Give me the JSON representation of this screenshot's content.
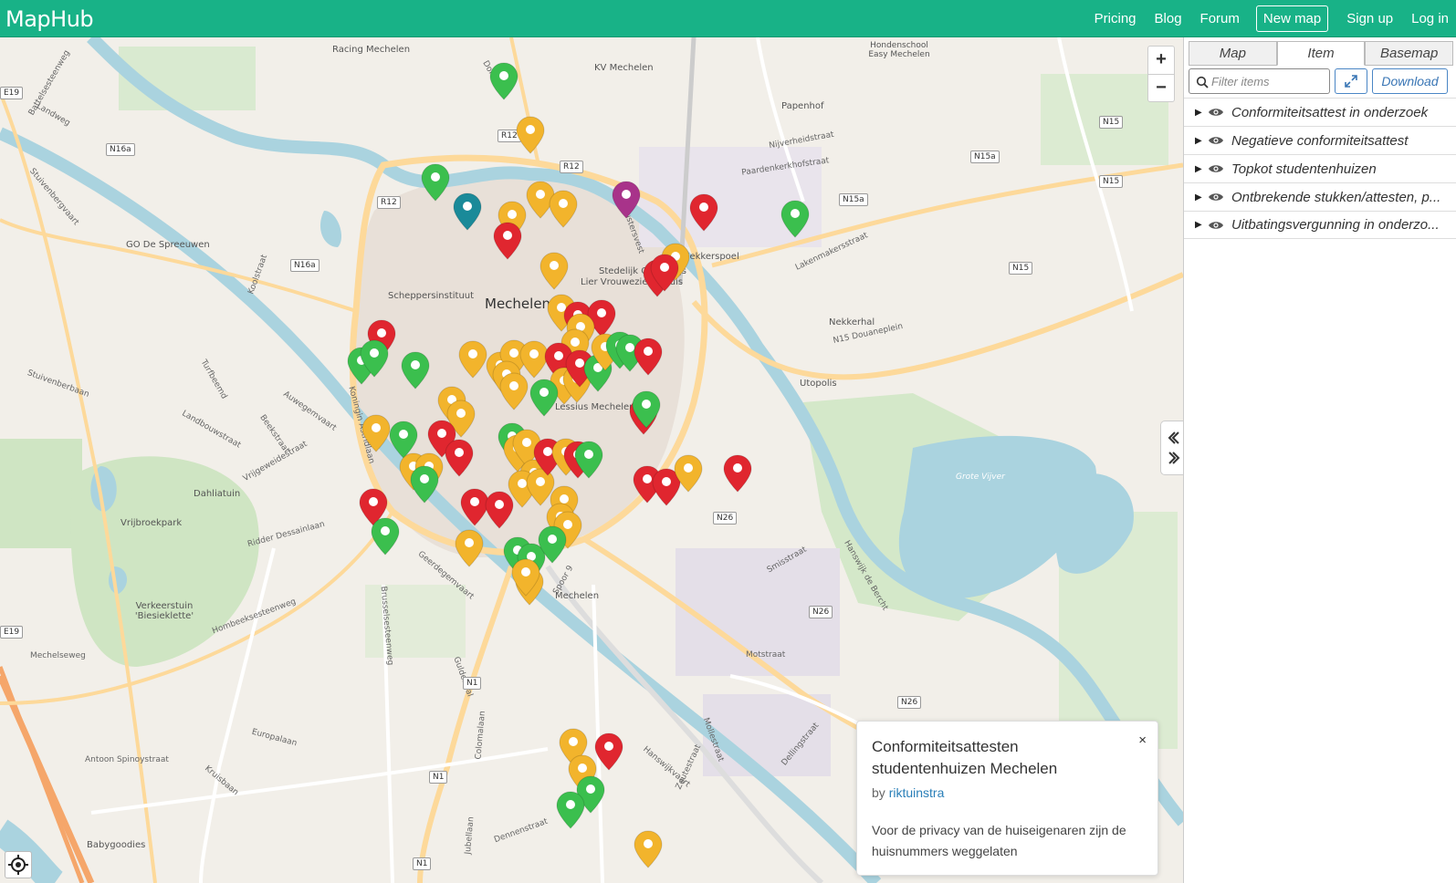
{
  "navbar": {
    "brand": "MapHub",
    "links": [
      "Pricing",
      "Blog",
      "Forum",
      "New map",
      "Sign up",
      "Log in"
    ]
  },
  "map": {
    "place_labels": [
      "Mechelen",
      "Racing Mechelen",
      "KV Mechelen",
      "Hondenschool Easy Mechelen",
      "Papenhof",
      "GO De Spreeuwen",
      "Scheppersinstituut",
      "Stedelijk Onderwijs",
      "Lier Vrouweziekenhuis",
      "Nekkerspoel",
      "Lessius Mechelen",
      "Nekkerhal",
      "Utopolis",
      "Dahliatuin",
      "Vrijbroekpark",
      "Verkeerstuin 'Biesieklette'",
      "Babygoodies",
      "Mechelen",
      "Grote Vijver"
    ],
    "road_labels": [
      "Battelsesteenweg",
      "Landweg",
      "Stuivenbergvaart",
      "Koolstraat",
      "Stuivenberbaan",
      "Turfbeemd",
      "Landbouwstraat",
      "Beekstraat",
      "Auwegemvaart",
      "Vrijgeweidestraat",
      "Ridder Dessainlaan",
      "Hombeeksesteenweg",
      "Mechelseweg",
      "Europalaan",
      "Antoon Spinoystraat",
      "Kruisbaan",
      "Brusselsesteenweg",
      "Colomalaan",
      "Dennenstraat",
      "Jubellaan",
      "Hanswijkvaart",
      "Zeutestraat",
      "Motstraat",
      "Dellingstraat",
      "Smisstraat",
      "Hanswijk de Bercht",
      "Nijverheidstraat",
      "Paardenkerkhofstraat",
      "Lakenmakersstraat",
      "N15 Douaneplein",
      "Donkerlei",
      "Koningin Astridlaan",
      "Geerdegemvaart",
      "Zwartzustersvest",
      "Spoor 9",
      "Mollestraat",
      "Guldendal"
    ],
    "route_shields": [
      "N16a",
      "N16a",
      "N16a",
      "R12",
      "R12",
      "R12",
      "N15",
      "N15",
      "N15",
      "N15a",
      "N15a",
      "N26",
      "N26",
      "N26",
      "N1",
      "N1",
      "N1",
      "E19",
      "E19"
    ],
    "zoom_in": "+",
    "zoom_out": "−",
    "marker_colors": {
      "green": "#3bbf4e",
      "orange": "#f2b42c",
      "red": "#e0262f",
      "purple": "#a8338a",
      "teal": "#1a8a99"
    }
  },
  "popup": {
    "title": "Conformiteitsattesten studentenhuizen Mechelen",
    "by_prefix": "by",
    "author": "riktuinstra",
    "description": "Voor de privacy van de huiseigenaren zijn de huisnummers weggelaten",
    "close": "×"
  },
  "panel": {
    "tabs": [
      "Map",
      "Item",
      "Basemap"
    ],
    "active_tab": "Item",
    "filter_placeholder": "Filter items",
    "expand_icon": "expand-icon",
    "download_label": "Download",
    "layers": [
      "Conformiteitsattest in onderzoek",
      "Negatieve conformiteitsattest",
      "Topkot studentenhuizen",
      "Ontbrekende stukken/attesten, p...",
      "Uitbatingsvergunning in onderzo..."
    ]
  }
}
